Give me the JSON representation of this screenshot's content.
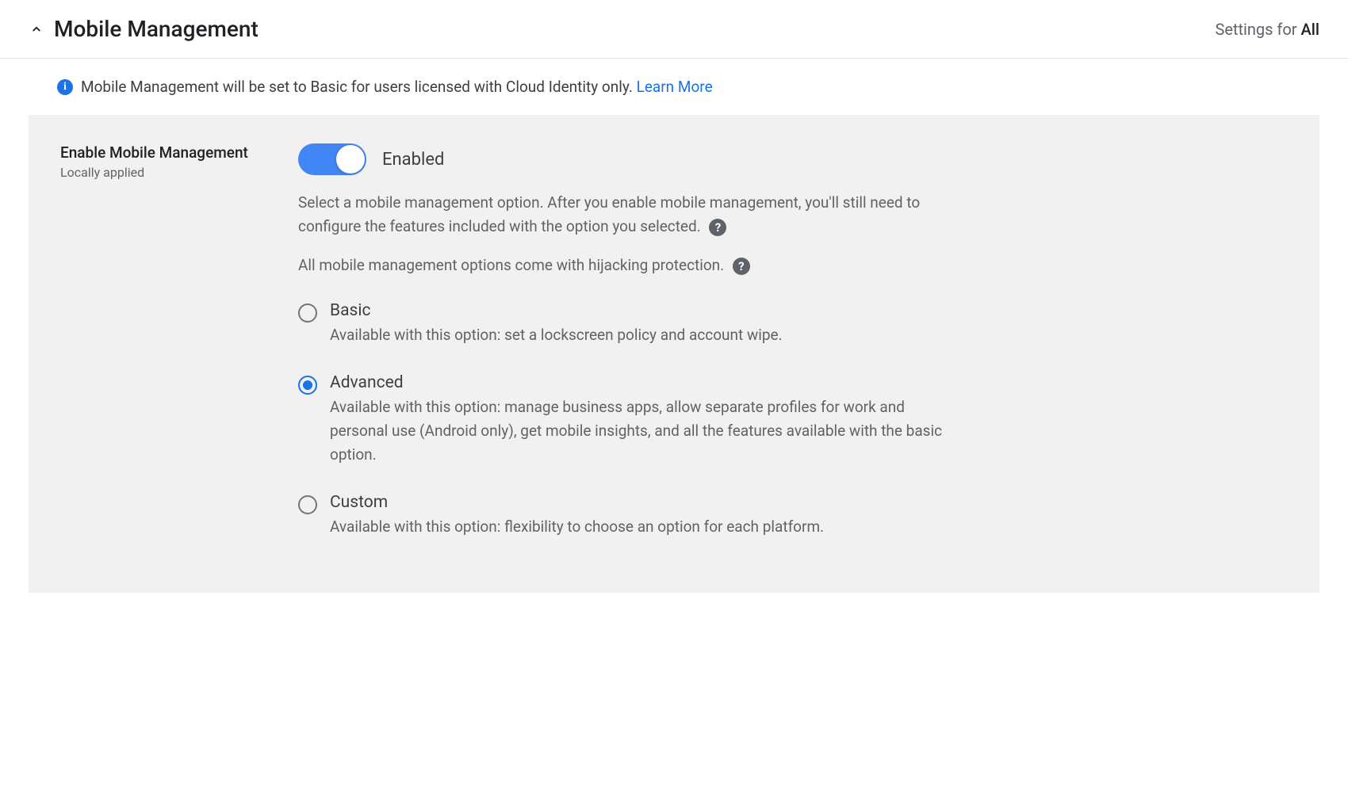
{
  "header": {
    "title": "Mobile Management",
    "settings_for_prefix": "Settings for ",
    "settings_for_value": "All"
  },
  "info_banner": {
    "text": "Mobile Management will be set to Basic for users licensed with Cloud Identity only. ",
    "learn_more": "Learn More"
  },
  "setting": {
    "label": "Enable Mobile Management",
    "sublabel": "Locally applied",
    "toggle_label": "Enabled",
    "description1": "Select a mobile management option. After you enable mobile management, you'll still need to configure the features included with the option you selected.",
    "description2": "All mobile management options come with hijacking protection.",
    "options": [
      {
        "title": "Basic",
        "description": "Available with this option: set a lockscreen policy and account wipe.",
        "selected": false
      },
      {
        "title": "Advanced",
        "description": "Available with this option: manage business apps, allow separate profiles for work and personal use (Android only), get mobile insights, and all the features available with the basic option.",
        "selected": true
      },
      {
        "title": "Custom",
        "description": "Available with this option: flexibility to choose an option for each platform.",
        "selected": false
      }
    ]
  }
}
